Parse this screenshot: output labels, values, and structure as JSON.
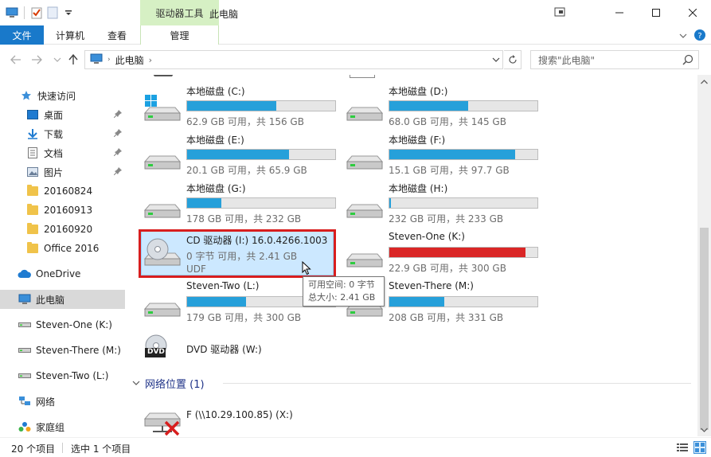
{
  "window": {
    "title": "此电脑",
    "context_tab": "驱动器工具"
  },
  "ribbon": {
    "tabs": [
      {
        "label": "文件"
      },
      {
        "label": "计算机"
      },
      {
        "label": "查看"
      },
      {
        "label": "管理"
      }
    ]
  },
  "address": {
    "crumb": "此电脑",
    "search_placeholder": "搜索\"此电脑\""
  },
  "sidebar": {
    "items": [
      {
        "label": "快速访问",
        "icon": "star-icon"
      },
      {
        "label": "桌面",
        "icon": "desktop-icon",
        "pinned": true
      },
      {
        "label": "下载",
        "icon": "download-icon",
        "pinned": true
      },
      {
        "label": "文档",
        "icon": "document-icon",
        "pinned": true
      },
      {
        "label": "图片",
        "icon": "pictures-icon",
        "pinned": true
      },
      {
        "label": "20160824",
        "icon": "folder-icon"
      },
      {
        "label": "20160913",
        "icon": "folder-icon"
      },
      {
        "label": "20160920",
        "icon": "folder-icon"
      },
      {
        "label": "Office 2016",
        "icon": "folder-icon"
      },
      {
        "label": "OneDrive",
        "icon": "cloud-icon"
      },
      {
        "label": "此电脑",
        "icon": "computer-icon",
        "selected": true
      },
      {
        "label": "Steven-One (K:)",
        "icon": "drive-icon"
      },
      {
        "label": "Steven-There (M:)",
        "icon": "drive-icon"
      },
      {
        "label": "Steven-Two (L:)",
        "icon": "drive-icon"
      },
      {
        "label": "网络",
        "icon": "network-icon"
      },
      {
        "label": "家庭组",
        "icon": "homegroup-icon"
      }
    ]
  },
  "drives": [
    {
      "name": "本地磁盘 (C:)",
      "info": "62.9 GB 可用，共 156 GB",
      "used": 0.6
    },
    {
      "name": "本地磁盘 (D:)",
      "info": "68.0 GB 可用，共 145 GB",
      "used": 0.53
    },
    {
      "name": "本地磁盘 (E:)",
      "info": "20.1 GB 可用，共 65.9 GB",
      "used": 0.69
    },
    {
      "name": "本地磁盘 (F:)",
      "info": "15.1 GB 可用，共 97.7 GB",
      "used": 0.85
    },
    {
      "name": "本地磁盘 (G:)",
      "info": "178 GB 可用，共 232 GB",
      "used": 0.23
    },
    {
      "name": "本地磁盘 (H:)",
      "info": "232 GB 可用，共 233 GB",
      "used": 0.01
    },
    {
      "name": "CD 驱动器 (I:) 16.0.4266.1003",
      "info": "0 字节 可用，共 2.41 GB",
      "fs": "UDF"
    },
    {
      "name": "Steven-One (K:)",
      "info": "22.9 GB 可用，共 300 GB",
      "used": 0.92
    },
    {
      "name": "Steven-Two (L:)",
      "info": "179 GB 可用，共 300 GB",
      "used": 0.4
    },
    {
      "name": "Steven-There (M:)",
      "info": "208 GB 可用，共 331 GB",
      "used": 0.37
    },
    {
      "name": "DVD 驱动器 (W:)"
    }
  ],
  "dvd_label": "DVD",
  "network_group": {
    "title": "网络位置 (1)",
    "items": [
      {
        "name": "F (\\\\10.29.100.85) (X:)"
      }
    ]
  },
  "tooltip": {
    "line1": "可用空间: 0 字节",
    "line2": "总大小: 2.41 GB"
  },
  "status": {
    "count": "20 个项目",
    "selected": "选中 1 个项目"
  },
  "colors": {
    "accent": "#1979ca",
    "bar": "#26a0da",
    "bar_full": "#da2626",
    "selection": "#cce8ff",
    "highlight_frame": "#d81e1e",
    "context_tab": "#d6f0c4"
  }
}
